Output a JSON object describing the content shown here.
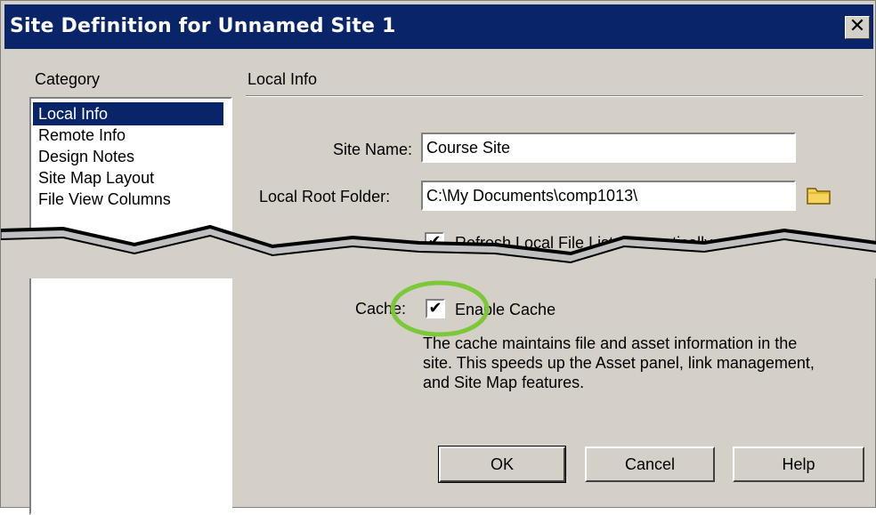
{
  "window": {
    "title": "Site Definition for Unnamed Site 1",
    "close_label": "✕"
  },
  "category": {
    "heading": "Category",
    "items": [
      {
        "label": "Local Info",
        "selected": true
      },
      {
        "label": "Remote Info",
        "selected": false
      },
      {
        "label": "Design Notes",
        "selected": false
      },
      {
        "label": "Site Map Layout",
        "selected": false
      },
      {
        "label": "File View Columns",
        "selected": false
      }
    ]
  },
  "panel": {
    "heading": "Local Info",
    "site_name_label": "Site Name:",
    "site_name_value": "Course Site",
    "root_folder_label": "Local Root Folder:",
    "root_folder_value": "C:\\My Documents\\comp1013\\",
    "refresh_label": "Refresh Local File List Automatically",
    "refresh_checked": true,
    "cache_label": "Cache:",
    "enable_cache_label": "Enable Cache",
    "enable_cache_checked": true,
    "cache_description": "The cache maintains file and asset information in the site.  This speeds up the Asset panel, link management, and Site Map features."
  },
  "buttons": {
    "ok": "OK",
    "cancel": "Cancel",
    "help": "Help"
  },
  "icons": {
    "folder": "folder-icon",
    "check": "✔",
    "highlight_color": "#7dc83a"
  }
}
